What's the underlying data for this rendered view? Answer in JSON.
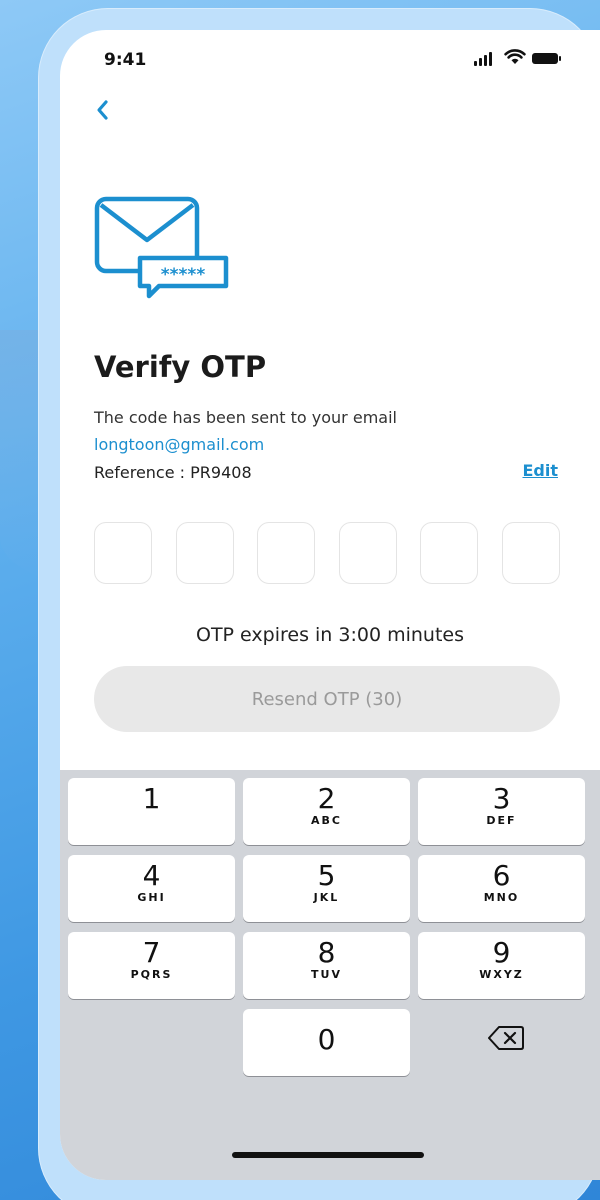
{
  "status_bar": {
    "time": "9:41"
  },
  "header": {
    "title": "Verify OTP",
    "subtitle": "The code has been sent to your email",
    "email": "longtoon@gmail.com",
    "reference": "Reference : PR9408",
    "edit_label": "Edit"
  },
  "icon": {
    "mail_code_text": "*****"
  },
  "otp": {
    "boxes": [
      "",
      "",
      "",
      "",
      "",
      ""
    ]
  },
  "timer": {
    "text": "OTP expires in 3:00 minutes"
  },
  "resend_button": {
    "label": "Resend OTP (30)"
  },
  "keypad": {
    "keys": [
      {
        "digit": "1",
        "letters": ""
      },
      {
        "digit": "2",
        "letters": "ABC"
      },
      {
        "digit": "3",
        "letters": "DEF"
      },
      {
        "digit": "4",
        "letters": "GHI"
      },
      {
        "digit": "5",
        "letters": "JKL"
      },
      {
        "digit": "6",
        "letters": "MNO"
      },
      {
        "digit": "7",
        "letters": "PQRS"
      },
      {
        "digit": "8",
        "letters": "TUV"
      },
      {
        "digit": "9",
        "letters": "WXYZ"
      },
      {
        "digit": "0",
        "letters": ""
      }
    ]
  },
  "colors": {
    "accent": "#1c8fcf",
    "background": "#4ea3e8",
    "keyboard": "#d1d4d9"
  }
}
